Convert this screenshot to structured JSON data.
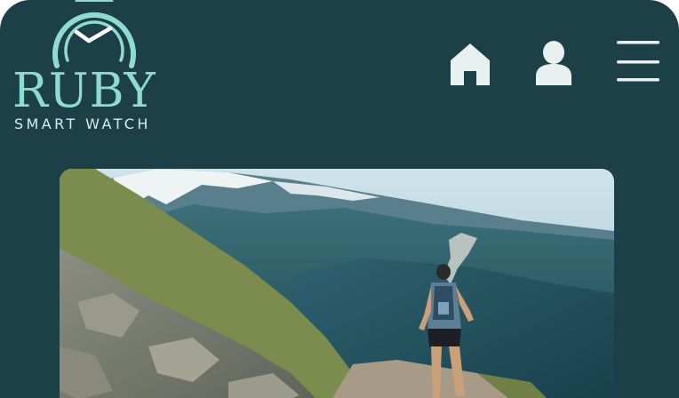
{
  "brand": {
    "name": "RUBY",
    "tagline": "SMART WATCH"
  },
  "nav": {
    "icons": [
      "home-icon",
      "user-icon",
      "menu-icon"
    ]
  },
  "hero": {
    "image": "trail-runner-mountain-photo"
  },
  "colors": {
    "background": "#1d3f48",
    "brand_accent": "#8fdccf",
    "icon": "#e9f1f0"
  }
}
